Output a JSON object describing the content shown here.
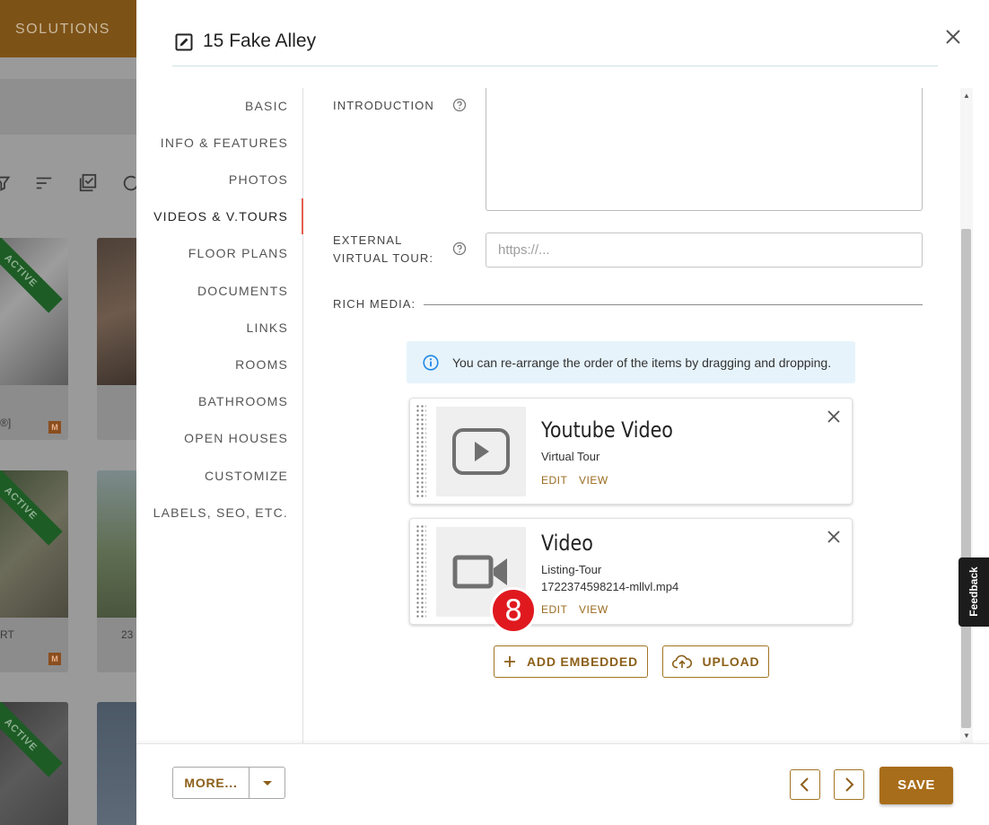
{
  "background_app": {
    "topbar_label": "SOLUTIONS",
    "cards": [
      {
        "ribbon": "ACTIVE",
        "caption": "®]",
        "badge": "M"
      },
      {
        "ribbon": "ACTIVE",
        "caption": "RT",
        "caption2": "23",
        "badge": "M"
      },
      {
        "ribbon": "ACTIVE"
      }
    ]
  },
  "modal": {
    "title": "15 Fake Alley",
    "nav": [
      {
        "label": "BASIC"
      },
      {
        "label": "INFO & FEATURES"
      },
      {
        "label": "PHOTOS"
      },
      {
        "label": "VIDEOS & V.TOURS",
        "active": true
      },
      {
        "label": "FLOOR PLANS"
      },
      {
        "label": "DOCUMENTS"
      },
      {
        "label": "LINKS"
      },
      {
        "label": "ROOMS"
      },
      {
        "label": "BATHROOMS"
      },
      {
        "label": "OPEN HOUSES"
      },
      {
        "label": "CUSTOMIZE"
      },
      {
        "label": "LABELS, SEO, ETC."
      }
    ],
    "fields": {
      "introduction_label": "INTRODUCTION",
      "introduction_value": "",
      "virtual_tour_label_1": "EXTERNAL",
      "virtual_tour_label_2": "VIRTUAL TOUR:",
      "virtual_tour_placeholder": "https://...",
      "virtual_tour_value": ""
    },
    "rich_media": {
      "label": "RICH MEDIA:",
      "info_text": "You can re-arrange the order of the items by dragging and dropping.",
      "items": [
        {
          "title": "Youtube Video",
          "subtitle": "Virtual Tour",
          "filename": "",
          "icon": "play-icon",
          "edit": "EDIT",
          "view": "VIEW"
        },
        {
          "title": "Video",
          "subtitle": "Listing-Tour",
          "filename": "1722374598214-mllvl.mp4",
          "icon": "video-camera-icon",
          "edit": "EDIT",
          "view": "VIEW"
        }
      ],
      "add_embedded_label": "ADD EMBEDDED",
      "upload_label": "UPLOAD"
    },
    "step_marker": "8",
    "footer": {
      "more_label": "MORE...",
      "save_label": "SAVE"
    }
  },
  "feedback_label": "Feedback",
  "colors": {
    "accent": "#a86d1a",
    "active_nav_marker": "#e2604b",
    "info_bg": "#e6f3fb",
    "step_marker": "#e0191f"
  }
}
